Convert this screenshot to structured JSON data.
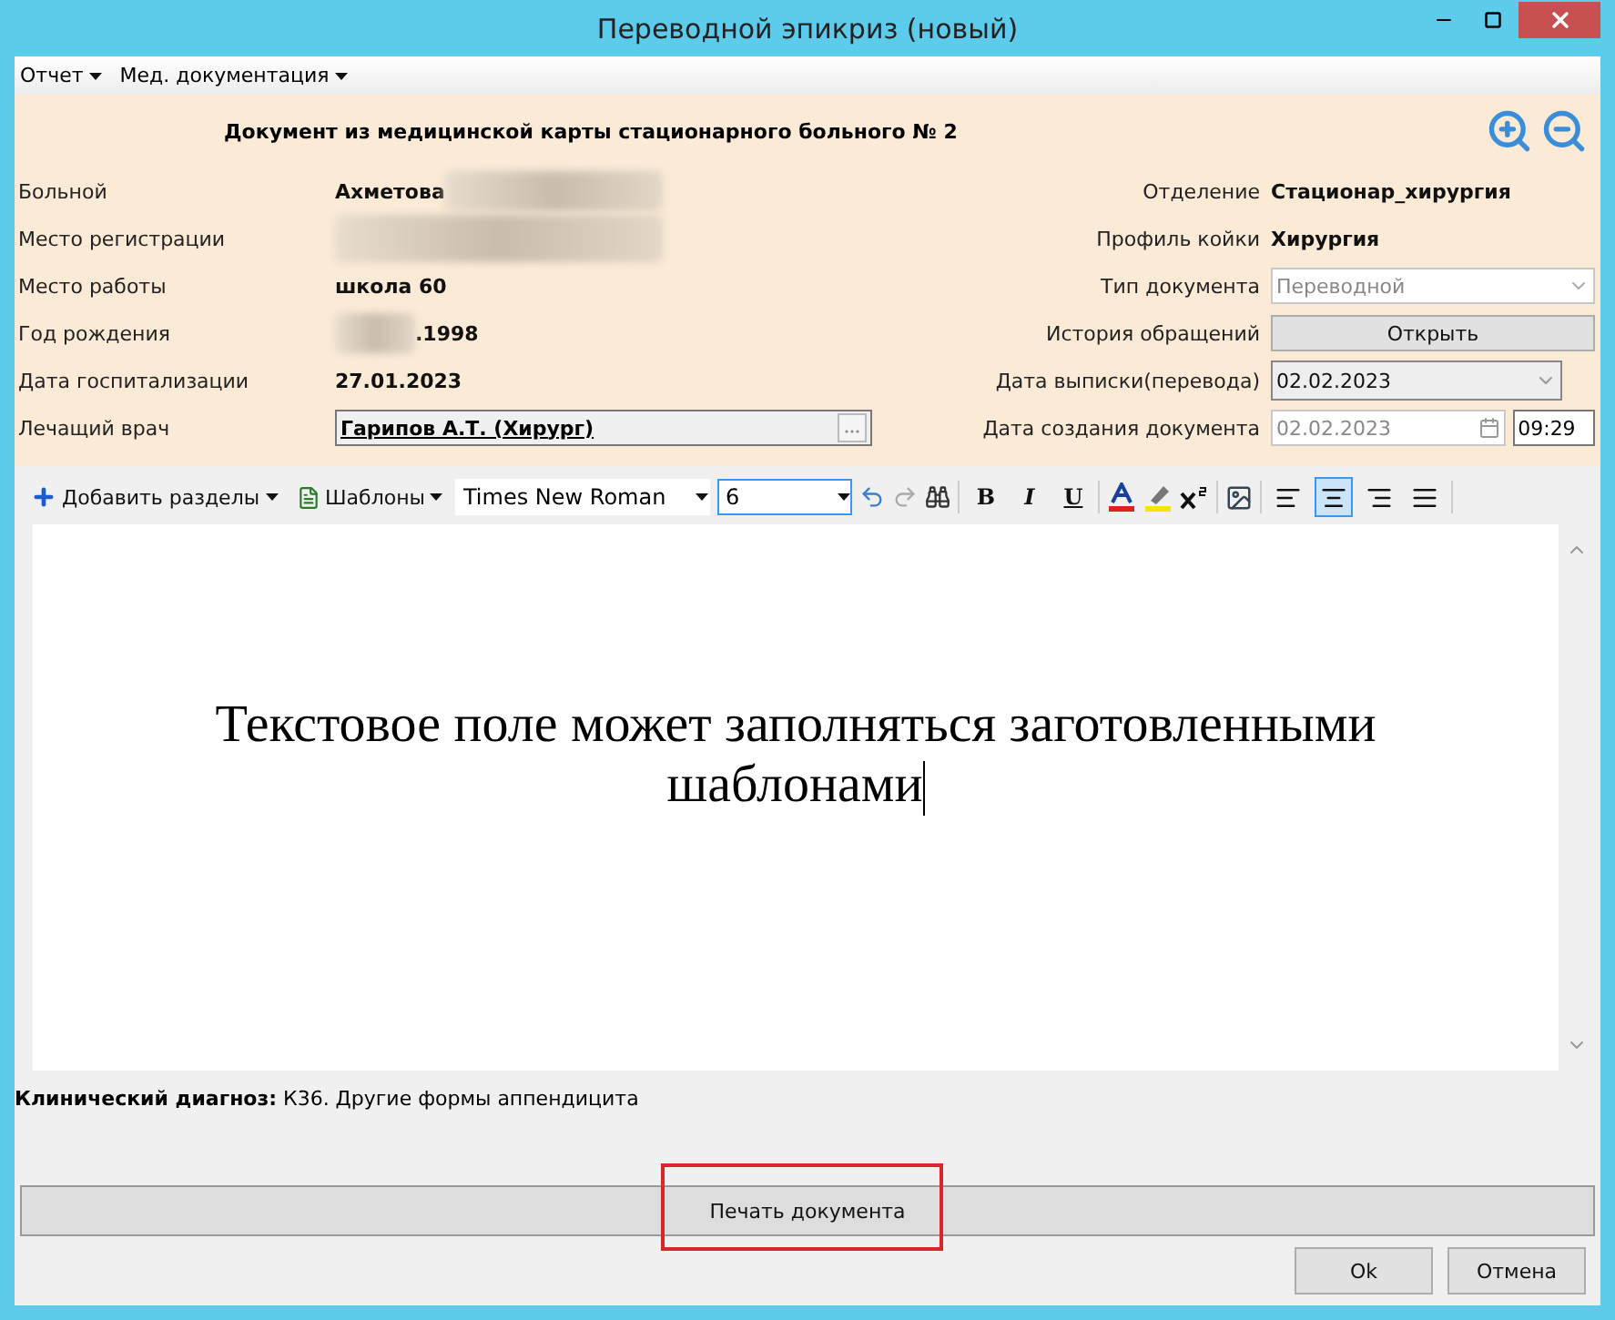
{
  "window": {
    "title": "Переводной эпикриз (новый)"
  },
  "menu": [
    {
      "label": "Отчет"
    },
    {
      "label": "Мед. документация"
    }
  ],
  "header": {
    "title": "Документ из медицинской карты стационарного больного №  2"
  },
  "left_fields": [
    {
      "label": "Больной",
      "kind": "text",
      "value": "Ахметова",
      "blurred_after": true
    },
    {
      "label": "Место регистрации",
      "kind": "blurred"
    },
    {
      "label": "Место работы",
      "kind": "text",
      "value": "школа 60"
    },
    {
      "label": "Год рождения",
      "kind": "text",
      "value": ".1998",
      "blurred_before": true
    },
    {
      "label": "Дата госпитализации",
      "kind": "text",
      "value": "27.01.2023"
    },
    {
      "label": "Лечащий врач",
      "kind": "lookup",
      "value": "Гарипов А.Т. (Хирург)"
    }
  ],
  "right_fields": [
    {
      "label": "Отделение",
      "kind": "text",
      "value": "Стационар_хирургия"
    },
    {
      "label": "Профиль койки",
      "kind": "text",
      "value": "Хирургия"
    },
    {
      "label": "Тип документа",
      "kind": "select",
      "value": "Переводной",
      "disabled": true
    },
    {
      "label": "История обращений",
      "kind": "button",
      "value": "Открыть"
    },
    {
      "label": "Дата выписки(перевода)",
      "kind": "date",
      "value": "02.02.2023",
      "disabled": false
    },
    {
      "label": "Дата создания документа",
      "kind": "datetime",
      "value": "02.02.2023",
      "time": "09:29",
      "disabled": true
    }
  ],
  "toolbar": {
    "add_sections": "Добавить разделы",
    "templates": "Шаблоны",
    "font": "Times New Roman",
    "font_size": "6",
    "format_buttons": [
      "B",
      "I",
      "U"
    ],
    "alignments": [
      {
        "selected": false
      },
      {
        "selected": true
      },
      {
        "selected": false
      },
      {
        "selected": false
      }
    ]
  },
  "editor": {
    "text": "Текстовое поле может заполняться заготовленными шаблонами"
  },
  "diagnosis": "**Клинический диагноз:** К36. Другие формы аппендицита",
  "print_button": "Печать документа",
  "buttons": [
    "Ok",
    "Отмена"
  ]
}
